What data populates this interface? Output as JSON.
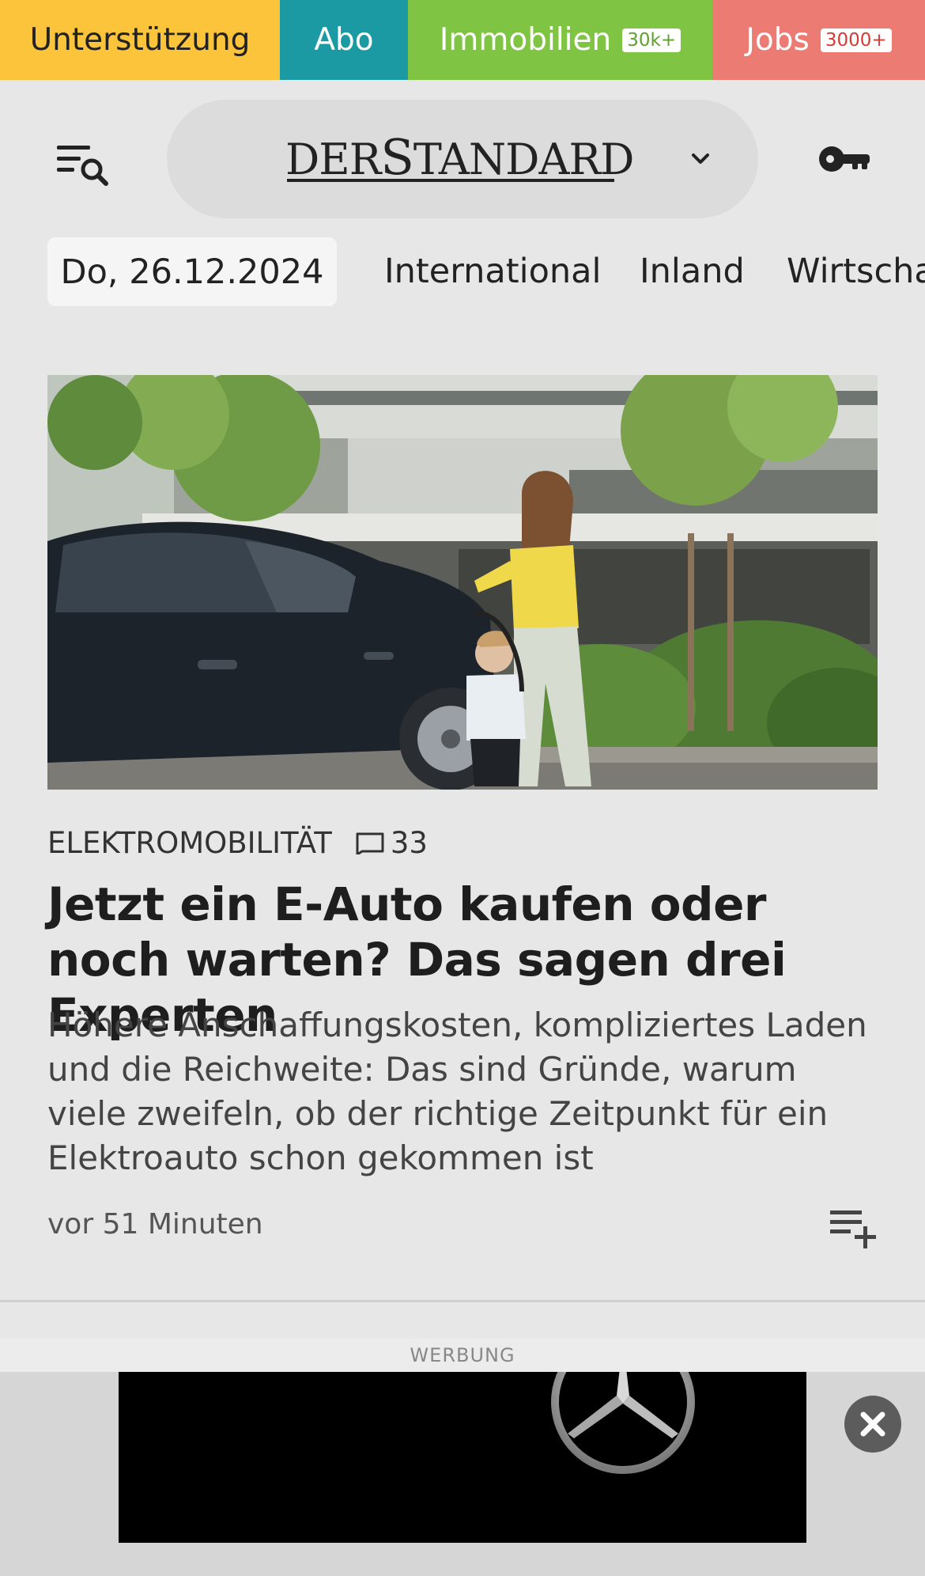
{
  "topbar": {
    "support": "Unterstützung",
    "abo": "Abo",
    "immobilien": "Immobilien",
    "immobilien_badge": "30k+",
    "jobs": "Jobs",
    "jobs_badge": "3000+"
  },
  "header": {
    "logo_part1": "DER",
    "logo_part2": "S",
    "logo_part3": "TANDARD"
  },
  "nav": {
    "date": "Do, 26.12.2024",
    "items": [
      "International",
      "Inland",
      "Wirtschaft"
    ]
  },
  "article": {
    "kicker": "ELEKTROMOBILITÄT",
    "comment_count": "33",
    "headline": "Jetzt ein E-Auto kaufen oder noch warten? Das sagen drei Experten",
    "lead": "Höhere Anschaffungskosten, kompliziertes Laden und die Reichweite: Das sind Gründe, warum viele zweifeln, ob der richtige Zeitpunkt für ein Elektroauto schon gekommen ist",
    "time": "vor 51 Minuten"
  },
  "ad": {
    "label": "WERBUNG"
  },
  "icons": {
    "menu": "menu-search-icon",
    "chevron": "chevron-down-icon",
    "key": "key-icon",
    "comment": "comment-icon",
    "playlist": "playlist-add-icon",
    "close": "close-icon"
  },
  "colors": {
    "support": "#fbc43a",
    "abo": "#1c9aa3",
    "immobilien": "#7fc543",
    "jobs": "#ec7b74",
    "page_bg": "#e7e7e7"
  }
}
